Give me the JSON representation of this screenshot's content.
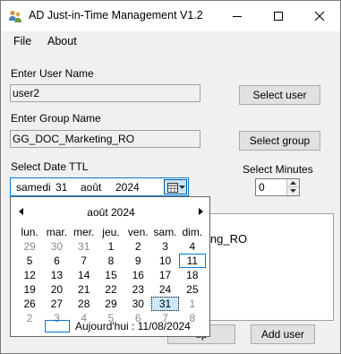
{
  "window": {
    "title": "AD Just-in-Time Management V1.2"
  },
  "menu": {
    "file": "File",
    "about": "About"
  },
  "form": {
    "user_label": "Enter User Name",
    "user_value": "user2",
    "select_user_button": "Select user",
    "group_label": "Enter Group Name",
    "group_value": "GG_DOC_Marketing_RO",
    "select_group_button": "Select group",
    "date_label": "Select Date TTL",
    "date_weekday": "samedi",
    "date_day": "31",
    "date_month": "août",
    "date_year": "2024",
    "minutes_label": "Select Minutes",
    "minutes_value": "0",
    "groupbox_text": "ing_RO",
    "add_user_button": "Add user",
    "partial_button_left": "",
    "partial_button_mid": "up"
  },
  "calendar": {
    "month_title": "août 2024",
    "weekdays": [
      "lun.",
      "mar.",
      "mer.",
      "jeu.",
      "ven.",
      "sam.",
      "dim."
    ],
    "weeks": [
      [
        "29",
        "30",
        "31",
        "1",
        "2",
        "3",
        "4"
      ],
      [
        "5",
        "6",
        "7",
        "8",
        "9",
        "10",
        "11"
      ],
      [
        "12",
        "13",
        "14",
        "15",
        "16",
        "17",
        "18"
      ],
      [
        "19",
        "20",
        "21",
        "22",
        "23",
        "24",
        "25"
      ],
      [
        "26",
        "27",
        "28",
        "29",
        "30",
        "31",
        "1"
      ],
      [
        "2",
        "3",
        "4",
        "5",
        "6",
        "7",
        "8"
      ]
    ],
    "today_text": "Aujourd'hui : 11/08/2024",
    "today_index": "1-6",
    "selected_index": "4-5",
    "other_month_cells": [
      "0-0",
      "0-1",
      "0-2",
      "4-6",
      "5-0",
      "5-1",
      "5-2",
      "5-3",
      "5-4",
      "5-5",
      "5-6"
    ]
  },
  "colors": {
    "accent": "#0078d7",
    "selected_bg": "#cce8ff",
    "window_bg": "#f0f0f0"
  }
}
